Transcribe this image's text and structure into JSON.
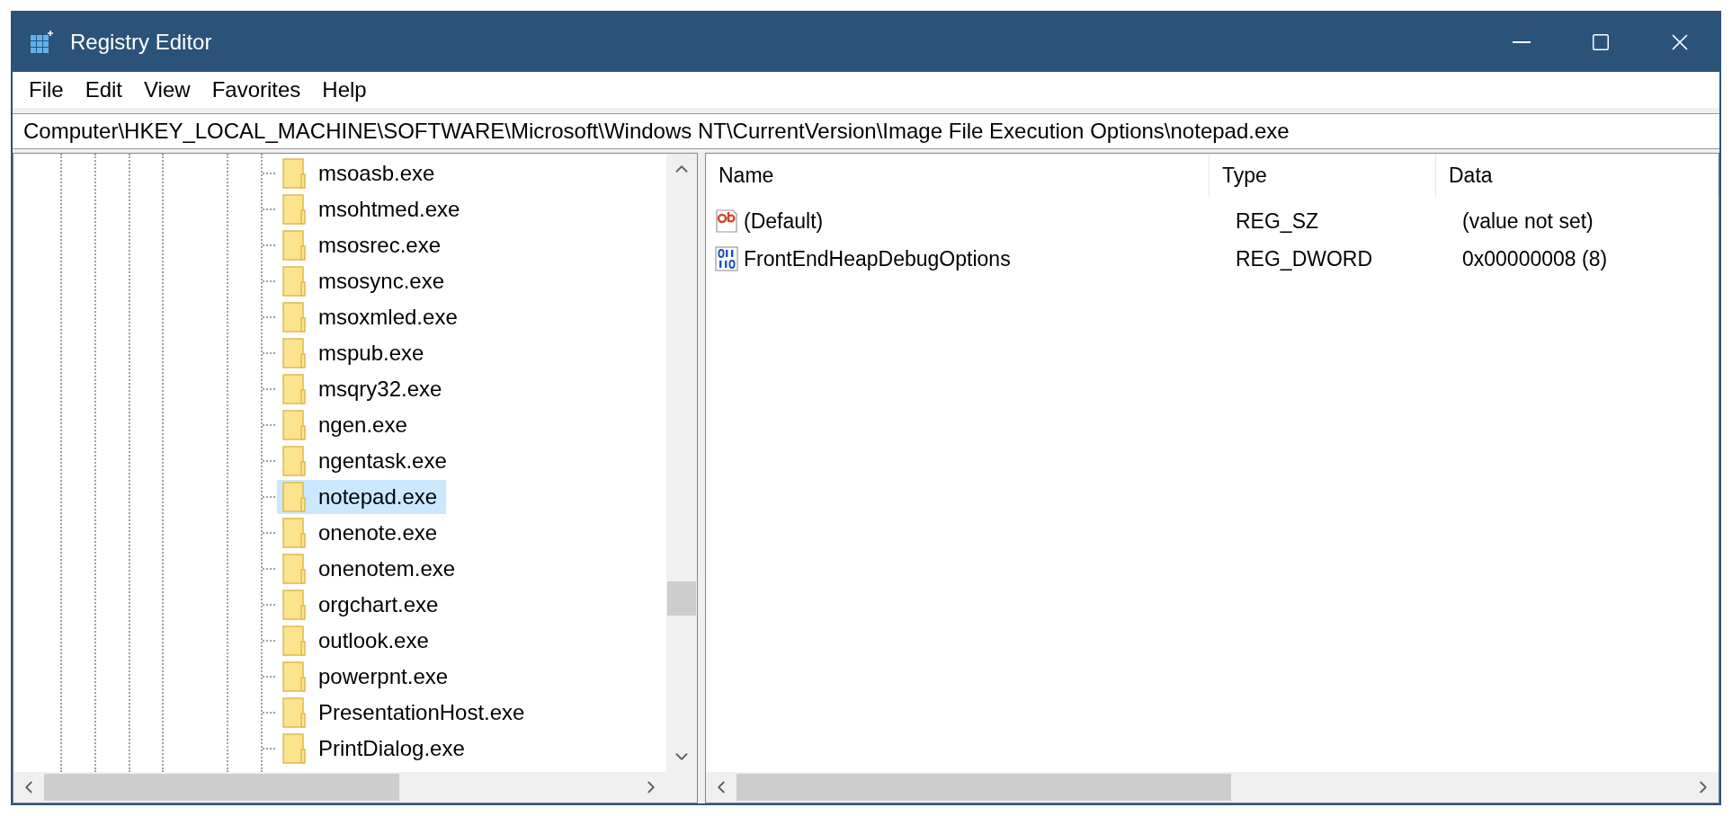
{
  "window": {
    "title": "Registry Editor"
  },
  "menu": [
    "File",
    "Edit",
    "View",
    "Favorites",
    "Help"
  ],
  "address": "Computer\\HKEY_LOCAL_MACHINE\\SOFTWARE\\Microsoft\\Windows NT\\CurrentVersion\\Image File Execution Options\\notepad.exe",
  "tree": {
    "items": [
      {
        "label": "msoasb.exe",
        "selected": false
      },
      {
        "label": "msohtmed.exe",
        "selected": false
      },
      {
        "label": "msosrec.exe",
        "selected": false
      },
      {
        "label": "msosync.exe",
        "selected": false
      },
      {
        "label": "msoxmled.exe",
        "selected": false
      },
      {
        "label": "mspub.exe",
        "selected": false
      },
      {
        "label": "msqry32.exe",
        "selected": false
      },
      {
        "label": "ngen.exe",
        "selected": false
      },
      {
        "label": "ngentask.exe",
        "selected": false
      },
      {
        "label": "notepad.exe",
        "selected": true
      },
      {
        "label": "onenote.exe",
        "selected": false
      },
      {
        "label": "onenotem.exe",
        "selected": false
      },
      {
        "label": "orgchart.exe",
        "selected": false
      },
      {
        "label": "outlook.exe",
        "selected": false
      },
      {
        "label": "powerpnt.exe",
        "selected": false
      },
      {
        "label": "PresentationHost.exe",
        "selected": false
      },
      {
        "label": "PrintDialog.exe",
        "selected": false
      }
    ]
  },
  "values": {
    "columns": [
      "Name",
      "Type",
      "Data"
    ],
    "rows": [
      {
        "kind": "string",
        "name": "(Default)",
        "type": "REG_SZ",
        "data": "(value not set)"
      },
      {
        "kind": "dword",
        "name": "FrontEndHeapDebugOptions",
        "type": "REG_DWORD",
        "data": "0x00000008 (8)"
      }
    ]
  }
}
